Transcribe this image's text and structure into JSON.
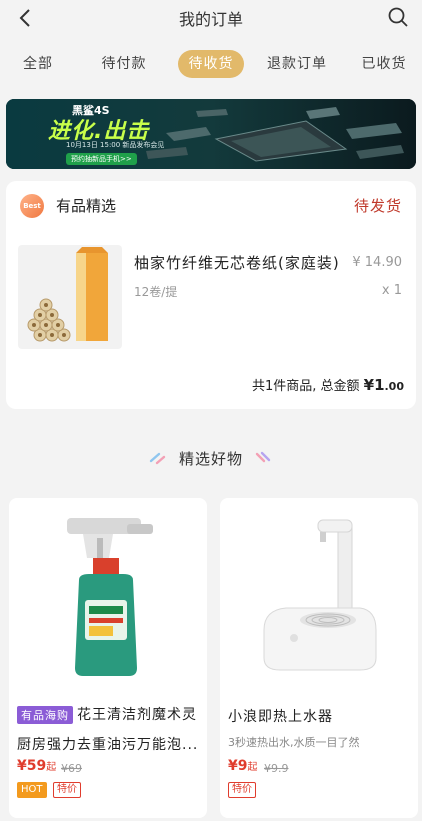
{
  "header": {
    "title": "我的订单"
  },
  "tabs": [
    {
      "label": "全部"
    },
    {
      "label": "待付款"
    },
    {
      "label": "待收货"
    },
    {
      "label": "退款订单"
    },
    {
      "label": "已收货"
    }
  ],
  "banner": {
    "brand": "黑鲨4S",
    "slogan": "进化.出击",
    "date_line": "10月13日 15:00 新品发布会见",
    "button": "预约抽新品手机>>"
  },
  "order": {
    "badge": "Best",
    "shop": "有品精选",
    "status": "待发货",
    "product_name": "柚家竹纤维无芯卷纸(家庭装)",
    "price": "¥ 14.90",
    "spec": "12卷/提",
    "qty": "x 1",
    "total_label": "共1件商品, 总金额",
    "total_symbol": "¥",
    "total_int": "1",
    "total_dec": ".00"
  },
  "section": {
    "title": "精选好物"
  },
  "goods": [
    {
      "tag": "有品海购",
      "name_line1": "花王清洁剂魔术灵",
      "name_line2": "厨房强力去重油污万能泡...",
      "price": "¥59",
      "price_suffix": "起",
      "orig": "¥69",
      "hot": "HOT",
      "special": "特价"
    },
    {
      "name_line1": "小浪即热上水器",
      "sub": "3秒速热出水,水质一目了然",
      "price": "¥9",
      "price_suffix": "起",
      "orig": "¥9.9",
      "special": "特价"
    }
  ],
  "colors": {
    "accent": "#e2b96a",
    "status_red": "#c0392b",
    "price_red": "#e03c2d"
  }
}
